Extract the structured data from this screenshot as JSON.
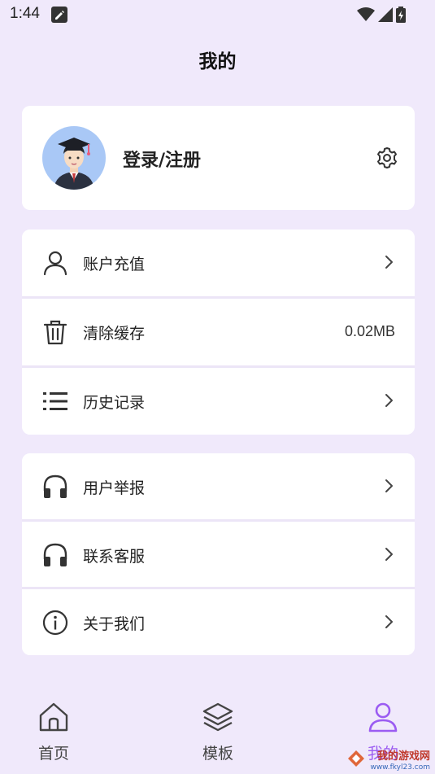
{
  "status": {
    "time": "1:44"
  },
  "header": {
    "title": "我的"
  },
  "profile": {
    "login_label": "登录/注册"
  },
  "menu_group_1": [
    {
      "icon": "user-icon",
      "label": "账户充值",
      "value": ""
    },
    {
      "icon": "trash-icon",
      "label": "清除缓存",
      "value": "0.02MB"
    },
    {
      "icon": "list-icon",
      "label": "历史记录",
      "value": ""
    }
  ],
  "menu_group_2": [
    {
      "icon": "headphones-icon",
      "label": "用户举报"
    },
    {
      "icon": "headphones-icon",
      "label": "联系客服"
    },
    {
      "icon": "info-icon",
      "label": "关于我们"
    }
  ],
  "tabbar": {
    "home": "首页",
    "templates": "模板",
    "mine": "我的"
  },
  "watermark": {
    "text": "我的游戏网",
    "url": "www.fkyl23.com"
  },
  "colors": {
    "accent": "#9b5cf2",
    "background": "#f0e9fb",
    "card": "#ffffff",
    "avatar_bg": "#a9c8f6"
  }
}
